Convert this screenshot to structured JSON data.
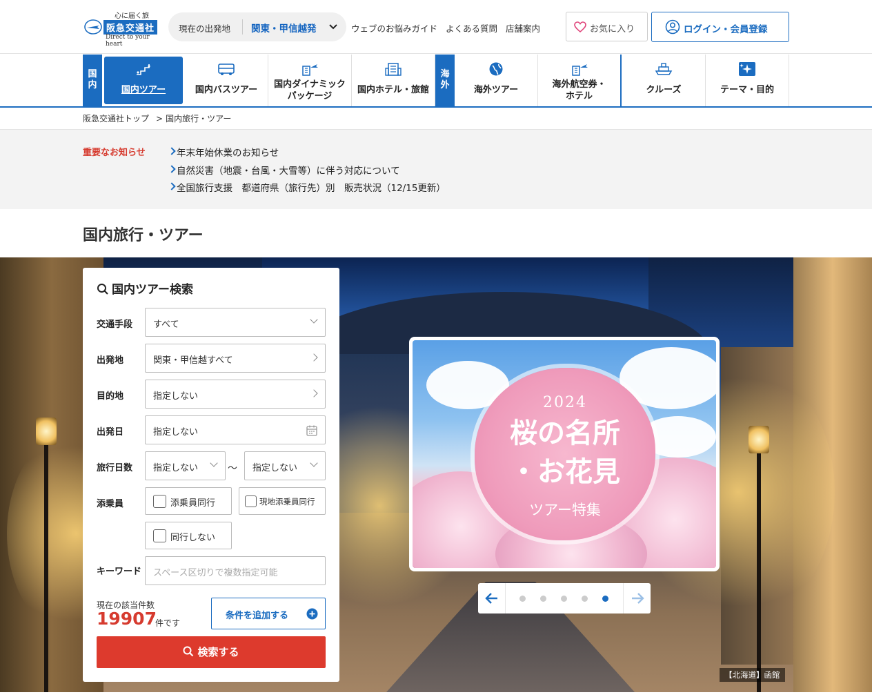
{
  "header": {
    "logo_tagline": "心に届く旅",
    "logo_brand": "阪急交通社",
    "logo_en": "Direct to your heart",
    "origin_label": "現在の出発地",
    "origin_value": "関東・甲信越発",
    "links": [
      "ウェブのお悩みガイド",
      "よくある質問",
      "店舗案内"
    ],
    "favorites_label": "お気に入り",
    "login_label": "ログイン・会員登録"
  },
  "nav": {
    "domestic_tag": "国内",
    "overseas_tag": "海外",
    "items": [
      {
        "label": "国内ツアー"
      },
      {
        "label": "国内バスツアー"
      },
      {
        "label1": "国内ダイナミック",
        "label2": "パッケージ"
      },
      {
        "label": "国内ホテル・旅館"
      },
      {
        "label": "海外ツアー"
      },
      {
        "label1": "海外航空券・",
        "label2": "ホテル"
      },
      {
        "label": "クルーズ"
      },
      {
        "label": "テーマ・目的"
      }
    ]
  },
  "breadcrumb": {
    "home": "阪急交通社トップ",
    "sep": ">",
    "current": "国内旅行・ツアー"
  },
  "notice": {
    "title": "重要なお知らせ",
    "items": [
      "年末年始休業のお知らせ",
      "自然災害（地震・台風・大雪等）に伴う対応について",
      "全国旅行支援　都道府県（旅行先）別　販売状況（12/15更新）"
    ]
  },
  "page_title": "国内旅行・ツアー",
  "search": {
    "title": "国内ツアー検索",
    "transport_label": "交通手段",
    "transport_value": "すべて",
    "departure_label": "出発地",
    "departure_value": "関東・甲信越すべて",
    "destination_label": "目的地",
    "destination_value": "指定しない",
    "date_label": "出発日",
    "date_value": "指定しない",
    "days_label": "旅行日数",
    "days_from": "指定しない",
    "days_tilde": "～",
    "days_to": "指定しない",
    "escort_label": "添乗員",
    "escort_opt1": "添乗員同行",
    "escort_opt2": "現地添乗員同行",
    "escort_opt3": "同行しない",
    "keyword_label": "キーワード",
    "keyword_placeholder": "スペース区切りで複数指定可能",
    "count_label": "現在の該当件数",
    "count_value": "19907",
    "count_unit": "件です",
    "add_condition": "条件を追加する",
    "submit": "検索する"
  },
  "banner": {
    "year": "2024",
    "line1": "桜の名所",
    "line2": "・お花見",
    "line3": "ツアー特集"
  },
  "carousel": {
    "total": 5,
    "active": 5
  },
  "hero_caption": "【北海道】函館",
  "colors": {
    "brand": "#1b6cc0",
    "accent": "#d63b2f",
    "button": "#dd3a2d"
  }
}
